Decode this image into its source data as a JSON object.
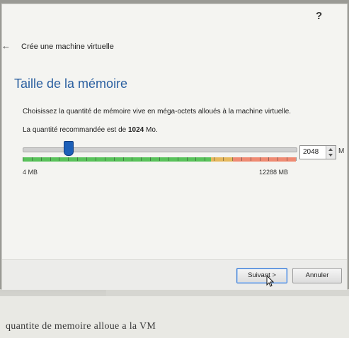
{
  "window": {
    "help_label": "?",
    "back_glyph": "←",
    "wizard_title": "Crée une machine virtuelle"
  },
  "page": {
    "section_title": "Taille de la mémoire",
    "description": "Choisissez la quantité de mémoire vive en méga-octets alloués à la machine virtuelle.",
    "recommended_prefix": "La quantité recommandée est de ",
    "recommended_value": "1024",
    "recommended_suffix": " Mo."
  },
  "memory": {
    "min_label": "4 MB",
    "max_label": "12288 MB",
    "value": "2048",
    "unit": "M",
    "slider_fraction": 0.167,
    "green_fraction": 0.69,
    "amber_fraction": 0.08,
    "red_fraction": 0.23
  },
  "buttons": {
    "next": "Suivant >",
    "cancel": "Annuler"
  },
  "background": {
    "paper_text": "quantite de memoire alloue a la VM"
  }
}
